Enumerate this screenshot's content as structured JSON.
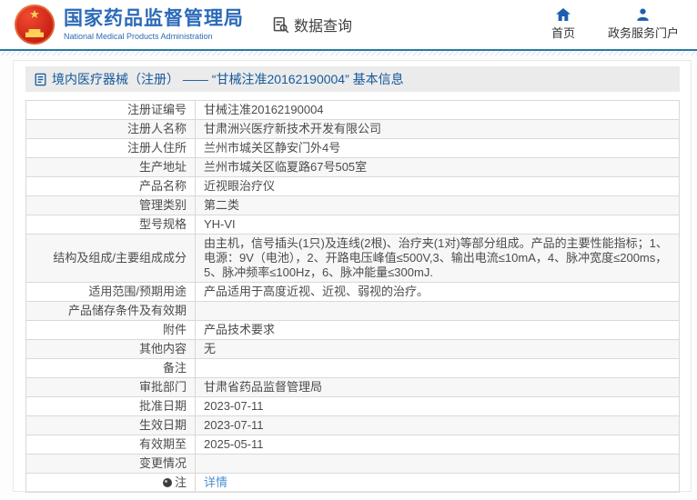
{
  "header": {
    "brand": {
      "title_zh": "国家药品监督管理局",
      "title_en": "National Medical Products Administration",
      "emblem": "china-national-emblem"
    },
    "data_query_label": "数据查询",
    "nav": [
      {
        "label": "首页",
        "icon": "home-icon"
      },
      {
        "label": "政务服务门户",
        "icon": "user-icon"
      }
    ]
  },
  "page": {
    "title": "境内医疗器械（注册） —— “甘械注准20162190004” 基本信息",
    "title_icon": "document-icon"
  },
  "table": {
    "rows": [
      {
        "label": "注册证编号",
        "value": "甘械注准20162190004"
      },
      {
        "label": "注册人名称",
        "value": "甘肃洲兴医疗新技术开发有限公司"
      },
      {
        "label": "注册人住所",
        "value": "兰州市城关区静安门外4号"
      },
      {
        "label": "生产地址",
        "value": "兰州市城关区临夏路67号505室"
      },
      {
        "label": "产品名称",
        "value": "近视眼治疗仪"
      },
      {
        "label": "管理类别",
        "value": "第二类"
      },
      {
        "label": "型号规格",
        "value": "YH-VI"
      },
      {
        "label": "结构及组成/主要组成成分",
        "value": "由主机，信号插头(1只)及连线(2根)、治疗夹(1对)等部分组成。产品的主要性能指标；1、电源：9V（电池），2、开路电压峰值≤500V,3、输出电流≤10mA，4、脉冲宽度≤200ms，5、脉冲频率≤100Hz，6、脉冲能量≤300mJ."
      },
      {
        "label": "适用范围/预期用途",
        "value": "产品适用于高度近视、近视、弱视的治疗。"
      },
      {
        "label": "产品储存条件及有效期",
        "value": ""
      },
      {
        "label": "附件",
        "value": "产品技术要求"
      },
      {
        "label": "其他内容",
        "value": "无"
      },
      {
        "label": "备注",
        "value": ""
      },
      {
        "label": "审批部门",
        "value": "甘肃省药品监督管理局"
      },
      {
        "label": "批准日期",
        "value": "2023-07-11"
      },
      {
        "label": "生效日期",
        "value": "2023-07-11"
      },
      {
        "label": "有效期至",
        "value": "2025-05-11"
      },
      {
        "label": "变更情况",
        "value": ""
      },
      {
        "label": "注",
        "label_icon": "note-icon",
        "value": "详情",
        "link": true
      }
    ]
  },
  "colors": {
    "brand_blue": "#2b6ab8",
    "header_rule": "#2d76a4",
    "title_text": "#15599c",
    "title_bar_bg": "#ebebeb",
    "link": "#4a90d2",
    "row_alt_bg": "#f7f7f7",
    "border": "#d9d9d9",
    "text": "#4c4c4c",
    "emblem_red": "#c61e12",
    "emblem_gold": "#ffd157"
  }
}
